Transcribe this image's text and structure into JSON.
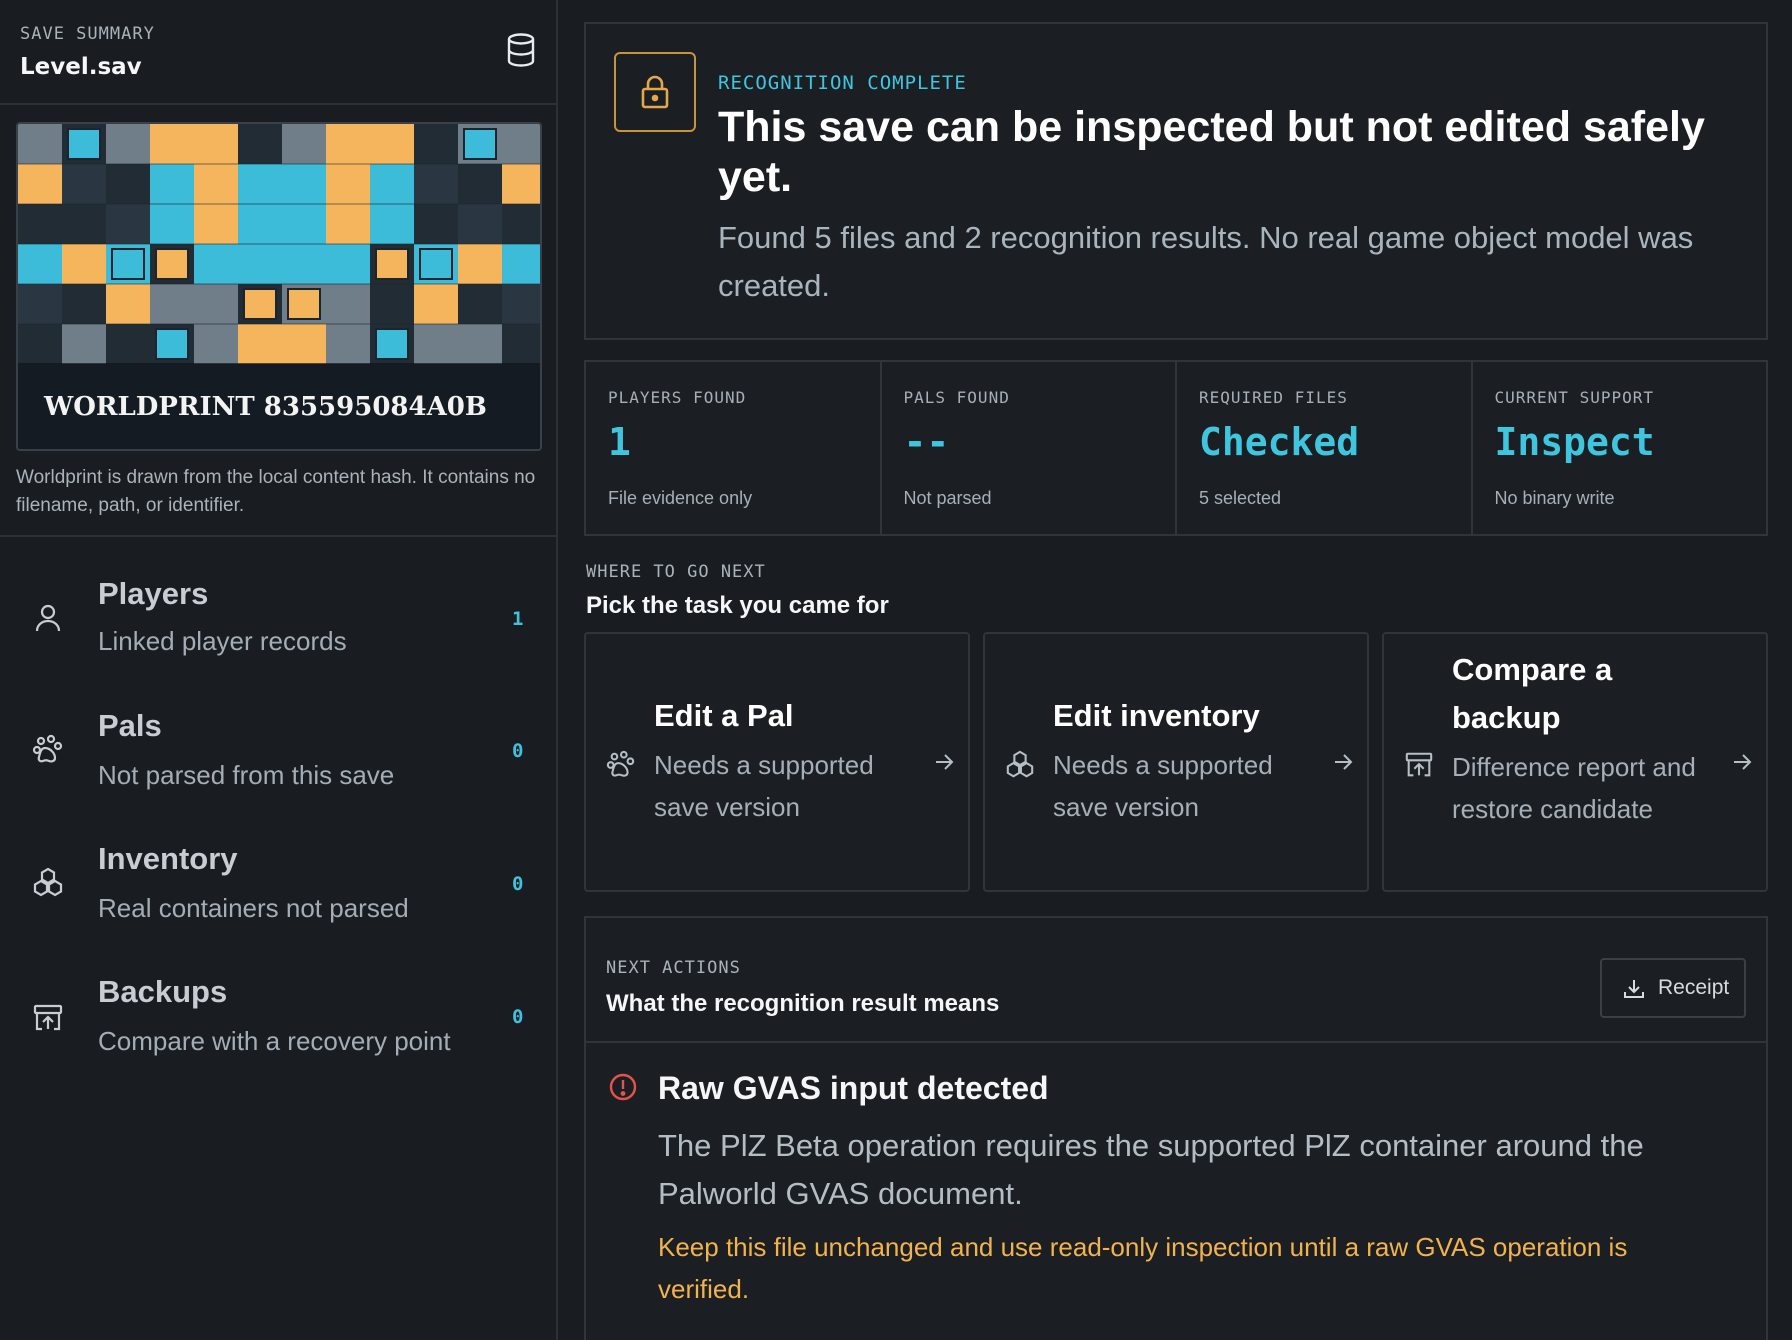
{
  "sidebar": {
    "kicker": "SAVE SUMMARY",
    "file_name": "Level.sav",
    "worldprint_label": "WORLDPRINT 835595084A0B",
    "worldprint_caption": "Worldprint is drawn from the local content hash. It contains no filename, path, or identifier.",
    "items": [
      {
        "title": "Players",
        "subtitle": "Linked player records",
        "count": "1",
        "icon": "person-icon"
      },
      {
        "title": "Pals",
        "subtitle": "Not parsed from this save",
        "count": "0",
        "icon": "paw-icon"
      },
      {
        "title": "Inventory",
        "subtitle": "Real containers not parsed",
        "count": "0",
        "icon": "boxes-icon"
      },
      {
        "title": "Backups",
        "subtitle": "Compare with a recovery point",
        "count": "0",
        "icon": "archive-restore-icon"
      }
    ]
  },
  "hero": {
    "kicker": "RECOGNITION COMPLETE",
    "title": "This save can be inspected but not edited safely yet.",
    "description": "Found 5 files and 2 recognition results. No real game object model was created."
  },
  "stats": [
    {
      "label": "PLAYERS FOUND",
      "value": "1",
      "note": "File evidence only"
    },
    {
      "label": "PALS FOUND",
      "value": "--",
      "note": "Not parsed"
    },
    {
      "label": "REQUIRED FILES",
      "value": "Checked",
      "note": "5 selected"
    },
    {
      "label": "CURRENT SUPPORT",
      "value": "Inspect",
      "note": "No binary write"
    }
  ],
  "next": {
    "kicker": "WHERE TO GO NEXT",
    "title": "Pick the task you came for",
    "tasks": [
      {
        "title": "Edit a Pal",
        "subtitle": "Needs a supported save version"
      },
      {
        "title": "Edit inventory",
        "subtitle": "Needs a supported save version"
      },
      {
        "title": "Compare a backup",
        "subtitle": "Difference report and restore candidate"
      }
    ]
  },
  "actions": {
    "kicker": "NEXT ACTIONS",
    "title": "What the recognition result means",
    "receipt_label": "Receipt",
    "alert_title": "Raw GVAS input detected",
    "alert_body": "The PlZ Beta operation requires the supported PlZ container around the Palworld GVAS document.",
    "alert_note": "Keep this file unchanged and use read-only inspection until a raw GVAS operation is verified."
  },
  "colors": {
    "accent_cyan": "#3fc6df",
    "accent_orange": "#f2b24c",
    "lock_border": "#c9933a",
    "alert_red": "#e5534b",
    "background": "#191d21"
  }
}
